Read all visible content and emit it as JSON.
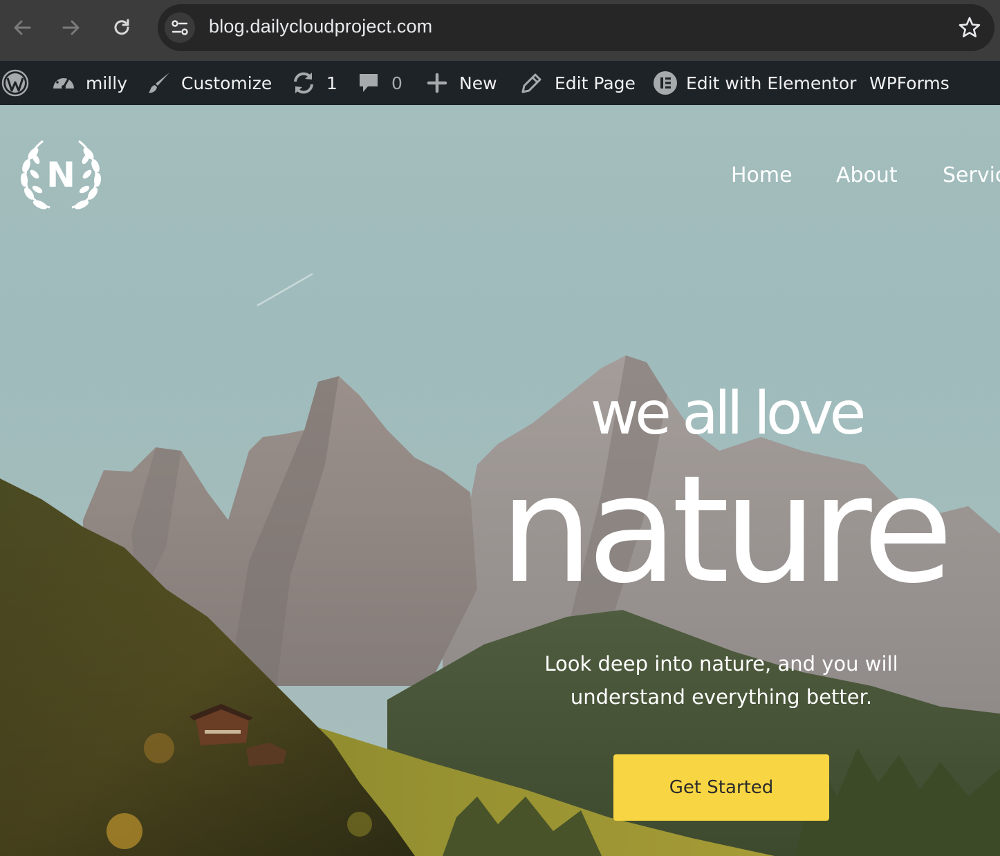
{
  "browser": {
    "url": "blog.dailycloudproject.com",
    "icons": [
      "back-arrow-icon",
      "forward-arrow-icon",
      "reload-icon",
      "site-settings-icon",
      "bookmark-star-icon"
    ]
  },
  "admin_bar": {
    "site_name": "milly",
    "customize": "Customize",
    "updates_count": "1",
    "comments_count": "0",
    "new_label": "New",
    "edit_page": "Edit Page",
    "elementor": "Edit with Elementor",
    "wpforms": "WPForms"
  },
  "site": {
    "logo_letter": "N",
    "menu": [
      "Home",
      "About",
      "Servic"
    ]
  },
  "hero": {
    "tagline": "we all love",
    "headline": "nature",
    "subtext_line1": "Look deep into nature, and you will",
    "subtext_line2": "understand everything better.",
    "cta_label": "Get Started",
    "cta_color": "#f8d542"
  }
}
